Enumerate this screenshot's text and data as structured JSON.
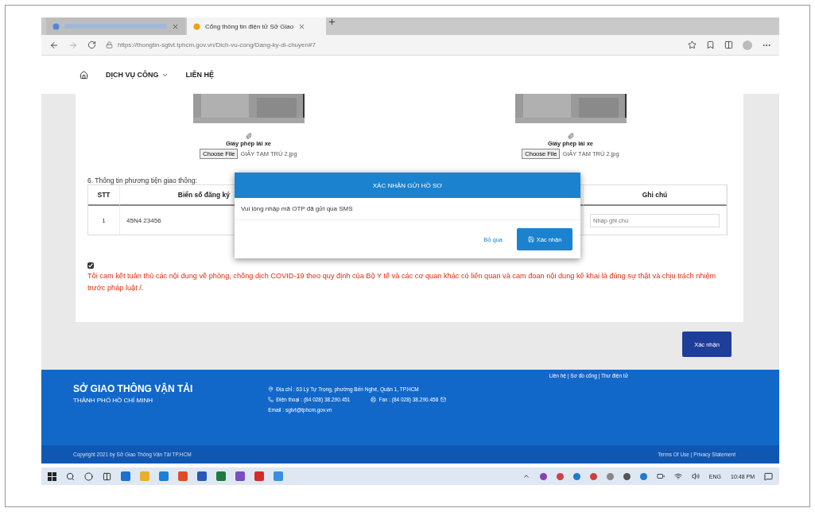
{
  "browser": {
    "tabs": [
      {
        "selected": false
      },
      {
        "title": "Cổng thông tin điện tử Sở Giao",
        "selected": true
      }
    ],
    "url": "https://thongtin-sgtvt.tphcm.gov.vn/Dich-vu-cong/Dang-ky-di-chuyen#7"
  },
  "nav": {
    "items": [
      {
        "label": "DỊCH VỤ CÔNG",
        "dropdown": true
      },
      {
        "label": "LIÊN HỆ",
        "dropdown": false
      }
    ]
  },
  "uploads": [
    {
      "label": "Giấy phép lái xe",
      "button": "Choose File",
      "file": "GIẤY TẠM TRÚ 2.jpg"
    },
    {
      "label": "Giấy phép lái xe",
      "button": "Choose File",
      "file": "GIẤY TẠM TRÚ 2.jpg"
    }
  ],
  "section_title": "6. Thông tin phương tiện giao thông:",
  "table": {
    "columns": [
      "STT",
      "Biển số đăng ký",
      "Ghi chú"
    ],
    "rows": [
      {
        "stt": "1",
        "plate": "45N4 23456",
        "note_placeholder": "Nhập ghi chú"
      }
    ]
  },
  "pledge": {
    "checked": true,
    "text": "Tôi cam kết tuân thủ các nội dung về phòng, chống dịch COVID-19 theo quy định của Bộ Y tế và các cơ quan khác có liên quan và cam đoan nội dung kê khai là đúng sự thật và chịu trách nhiệm trước pháp luật /."
  },
  "submit": "Xác nhận",
  "modal": {
    "title": "XÁC NHẬN GỬI HỒ SƠ",
    "message": "Vui lòng nhập mã OTP đã gửi qua SMS",
    "cancel": "Bỏ qua",
    "confirm": "Xác nhận"
  },
  "footer": {
    "links": "Liên hệ | Sơ đồ cổng | Thư điện tử",
    "org": "SỞ GIAO THÔNG VẬN TẢI",
    "city": "THÀNH PHỐ HỒ CHÍ MINH",
    "address": "Địa chỉ : 63 Lý Tự Trọng, phường Bến Nghé, Quận 1, TP.HCM",
    "phone": "Điện thoại : (84 028) 38.290.451",
    "fax": "Fax : (84 028) 38.290.458",
    "email": "Email : sgtvt@tphcm.gov.vn",
    "copyright": "Copyright 2021 by Sở Giao Thông Vận Tải TP.HCM",
    "legal": "Terms Of Use | Privacy Statement"
  },
  "taskbar": {
    "language": "ENG",
    "time": "10:48 PM"
  }
}
